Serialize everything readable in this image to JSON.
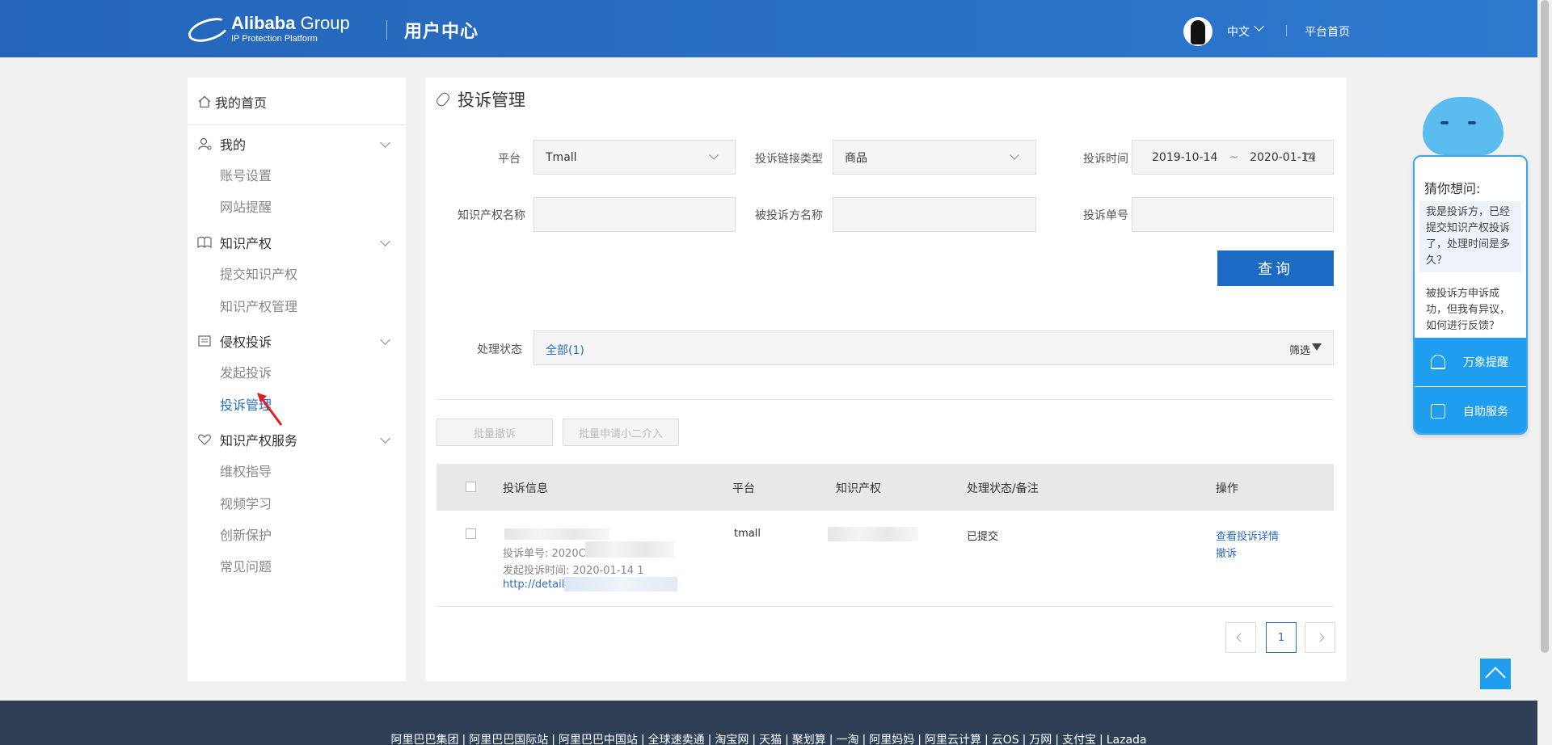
{
  "header": {
    "brand": "Alibaba",
    "brand_suffix": " Group",
    "platform": "IP Protection Platform",
    "title": "用户中心",
    "language": "中文",
    "home_link": "平台首页"
  },
  "sidebar": {
    "home": "我的首页",
    "sections": [
      {
        "title": "我的",
        "items": [
          "账号设置",
          "网站提醒"
        ]
      },
      {
        "title": "知识产权",
        "items": [
          "提交知识产权",
          "知识产权管理"
        ]
      },
      {
        "title": "侵权投诉",
        "items": [
          "发起投诉",
          "投诉管理"
        ]
      },
      {
        "title": "知识产权服务",
        "items": [
          "维权指导",
          "视频学习",
          "创新保护",
          "常见问题"
        ]
      }
    ],
    "active_item": "投诉管理"
  },
  "main": {
    "title": "投诉管理",
    "filters": {
      "platform_label": "平台",
      "platform_value": "Tmall",
      "link_type_label": "投诉链接类型",
      "link_type_value": "商品",
      "time_label": "投诉时间",
      "date_start": "2019-10-14",
      "date_sep": "~",
      "date_end": "2020-01-14",
      "ip_name_label": "知识产权名称",
      "ip_name_value": "",
      "respondent_label": "被投诉方名称",
      "respondent_value": "",
      "order_no_label": "投诉单号",
      "order_no_value": ""
    },
    "query_button": "查询",
    "status": {
      "label": "处理状态",
      "value": "全部(1)",
      "filter": "筛选"
    },
    "bulk_buttons": [
      "批量撤诉",
      "批量申请小二介入"
    ],
    "table": {
      "headers": [
        "投诉信息",
        "平台",
        "知识产权",
        "处理状态/备注",
        "操作"
      ],
      "rows": [
        {
          "order_no": "投诉单号: 2020C",
          "start_time": "发起投诉时间: 2020-01-14 1",
          "link": "http://detail",
          "platform": "tmall",
          "status": "已提交",
          "actions": [
            "查看投诉详情",
            "撤诉"
          ]
        }
      ]
    },
    "pagination": {
      "current": "1"
    }
  },
  "chat": {
    "title": "猜你想问:",
    "questions": [
      "我是投诉方，已经提交知识产权投诉了，处理时间是多久？",
      "被投诉方申诉成功，但我有异议，如何进行反馈？"
    ],
    "buttons": [
      "万象提醒",
      "自助服务"
    ]
  },
  "footer": {
    "links": [
      "阿里巴巴集团",
      "阿里巴巴国际站",
      "阿里巴巴中国站",
      "全球速卖通",
      "淘宝网",
      "天猫",
      "聚划算",
      "一淘",
      "阿里妈妈",
      "阿里云计算",
      "云OS",
      "万网",
      "支付宝",
      "Lazada"
    ],
    "separator": "|"
  },
  "colors": {
    "header_blue": "#2a6fc4",
    "accent": "#1b6bc4",
    "chat_blue": "#1f9ef0",
    "footer_bg": "#2f3f55"
  }
}
